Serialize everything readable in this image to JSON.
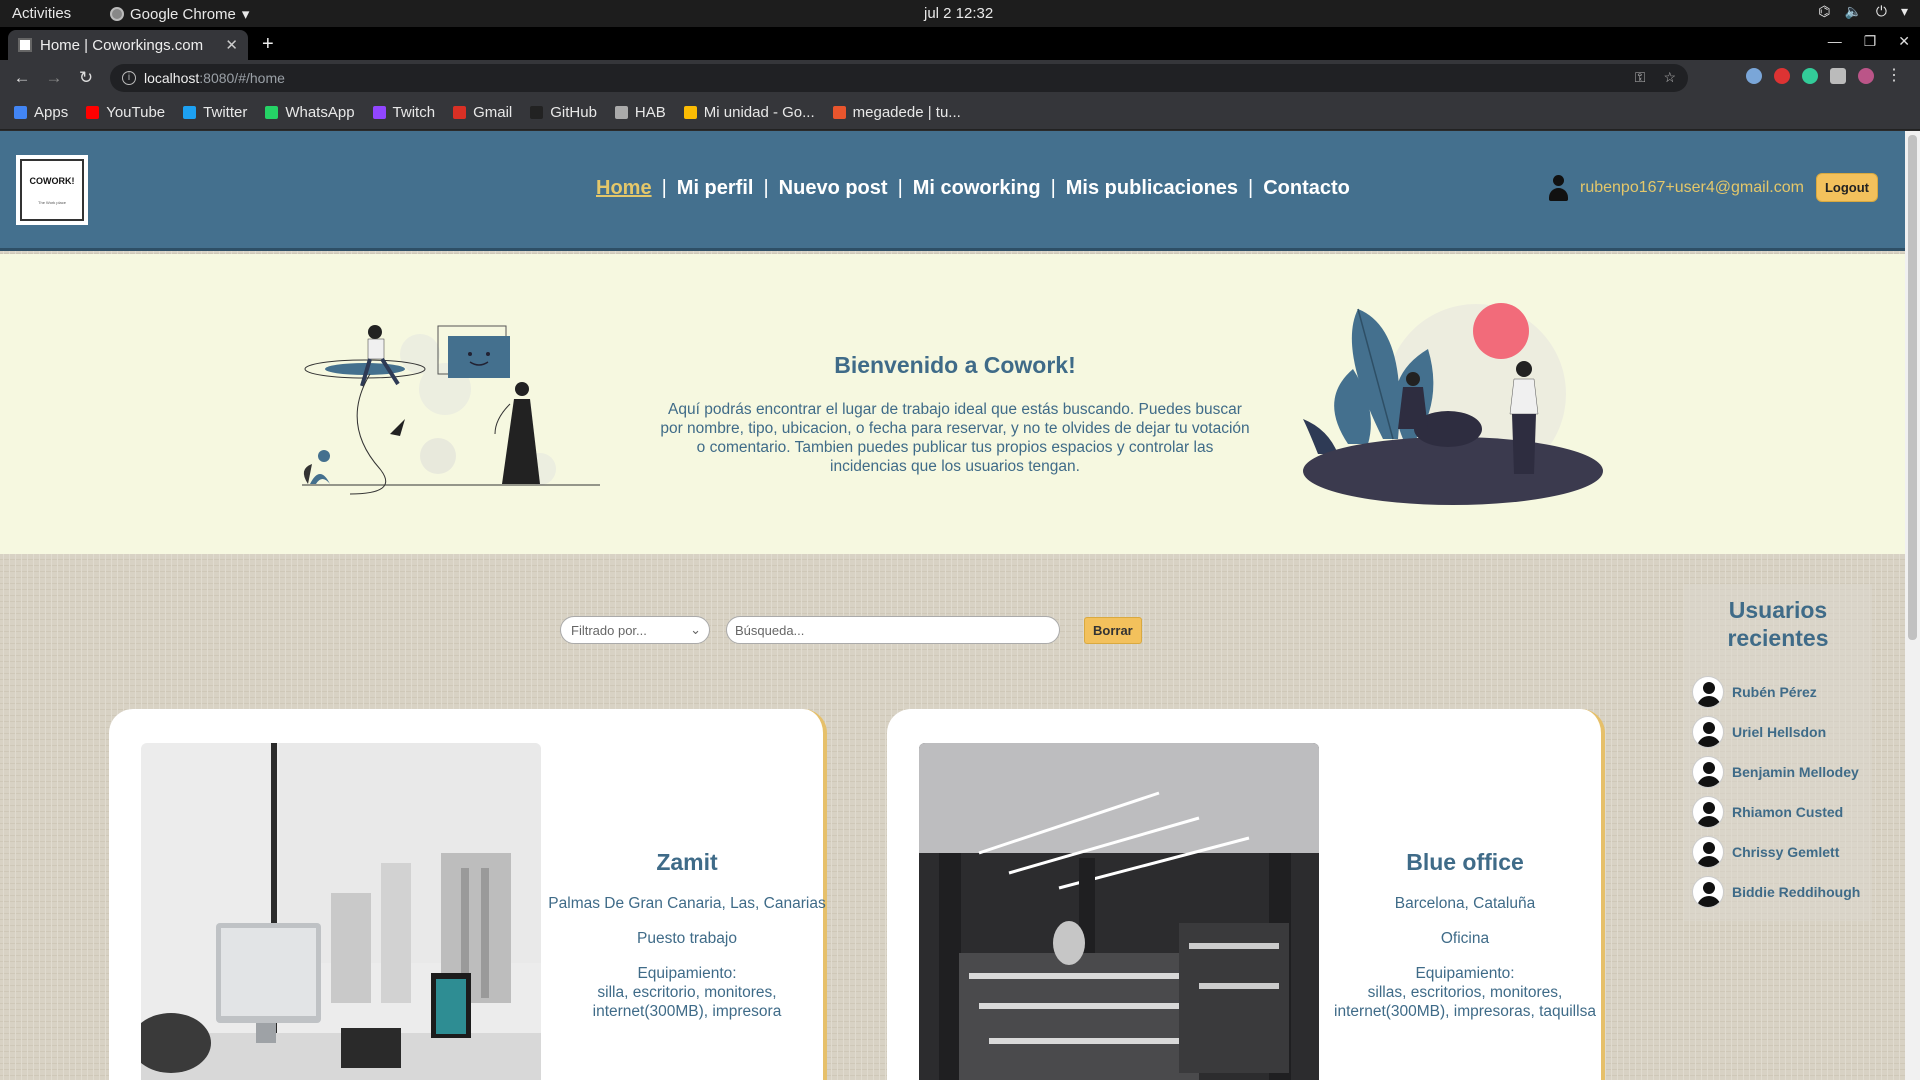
{
  "os": {
    "activities": "Activities",
    "app_name": "Google Chrome",
    "clock": "jul 2  12:32"
  },
  "browser": {
    "tab_title": "Home | Coworkings.com",
    "url_host": "localhost",
    "url_path": ":8080/#/home",
    "bookmarks": [
      {
        "label": "Apps",
        "color": "#4285f4"
      },
      {
        "label": "YouTube",
        "color": "#ff0000"
      },
      {
        "label": "Twitter",
        "color": "#1da1f2"
      },
      {
        "label": "WhatsApp",
        "color": "#25d366"
      },
      {
        "label": "Twitch",
        "color": "#9146ff"
      },
      {
        "label": "Gmail",
        "color": "#d93025"
      },
      {
        "label": "GitHub",
        "color": "#222222"
      },
      {
        "label": "HAB",
        "color": "#aaaaaa"
      },
      {
        "label": "Mi unidad - Go...",
        "color": "#fbbc04"
      },
      {
        "label": "megadede | tu...",
        "color": "#e8552d"
      }
    ]
  },
  "site": {
    "logo_text": "COWORK!",
    "logo_sub": "The Work place",
    "nav": [
      {
        "label": "Home",
        "active": true
      },
      {
        "label": "Mi perfil",
        "active": false
      },
      {
        "label": "Nuevo post",
        "active": false
      },
      {
        "label": "Mi coworking",
        "active": false
      },
      {
        "label": "Mis publicaciones",
        "active": false
      },
      {
        "label": "Contacto",
        "active": false
      }
    ],
    "user_email": "rubenpo167+user4@gmail.com",
    "logout_label": "Logout"
  },
  "hero": {
    "title": "Bienvenido a Cowork!",
    "text": "Aquí podrás encontrar el lugar de trabajo ideal que estás buscando. Puedes buscar por nombre, tipo, ubicacion, o fecha para reservar, y no te olvides de dejar tu votación o comentario. Tambien puedes publicar tus propios espacios y controlar las incidencias que los usuarios tengan."
  },
  "search": {
    "filter_placeholder": "Filtrado por...",
    "search_placeholder": "Búsqueda...",
    "clear_label": "Borrar"
  },
  "cards": [
    {
      "title": "Zamit",
      "location": "Palmas De Gran Canaria, Las, Canarias",
      "type": "Puesto trabajo",
      "equipment_label": "Equipamiento:",
      "equipment": "silla, escritorio, monitores, internet(300MB), impresora"
    },
    {
      "title": "Blue office",
      "location": "Barcelona, Cataluña",
      "type": "Oficina",
      "equipment_label": "Equipamiento:",
      "equipment": "sillas, escritorios, monitores, internet(300MB), impresoras, taquillsa"
    }
  ],
  "recent_users": {
    "title": "Usuarios recientes",
    "users": [
      "Rubén Pérez",
      "Uriel Hellsdon",
      "Benjamin Mellodey",
      "Rhiamon Custed",
      "Chrissy Gemlett",
      "Biddie Reddihough"
    ]
  },
  "colors": {
    "header_bg": "#44708e",
    "accent": "#e4c76a",
    "button": "#f3c15c",
    "hero_bg": "#f6f8e0",
    "text_primary": "#3f6b88"
  }
}
